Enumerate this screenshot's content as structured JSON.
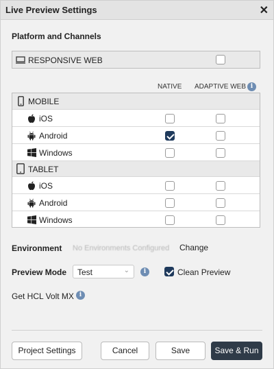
{
  "dialog": {
    "title": "Live Preview Settings",
    "close_glyph": "✕"
  },
  "platform_section": {
    "title": "Platform and Channels"
  },
  "responsive": {
    "label": "RESPONSIVE WEB",
    "checked": false
  },
  "columns": {
    "native": "NATIVE",
    "adaptive": "ADAPTIVE WEB",
    "info_glyph": "i"
  },
  "mobile": {
    "header": "MOBILE",
    "rows": [
      {
        "label": "iOS",
        "native": false,
        "adaptive": false
      },
      {
        "label": "Android",
        "native": true,
        "adaptive": false
      },
      {
        "label": "Windows",
        "native": false,
        "adaptive": false
      }
    ]
  },
  "tablet": {
    "header": "TABLET",
    "rows": [
      {
        "label": "iOS",
        "native": false,
        "adaptive": false
      },
      {
        "label": "Android",
        "native": false,
        "adaptive": false
      },
      {
        "label": "Windows",
        "native": false,
        "adaptive": false
      }
    ]
  },
  "environment": {
    "label": "Environment",
    "value": "No Environments Configured",
    "change": "Change"
  },
  "preview": {
    "label": "Preview Mode",
    "mode": "Test",
    "clean_label": "Clean Preview",
    "clean_checked": true
  },
  "get_volt": {
    "label": "Get HCL Volt MX"
  },
  "buttons": {
    "project_settings": "Project Settings",
    "cancel": "Cancel",
    "save": "Save",
    "save_run": "Save & Run"
  },
  "colors": {
    "accent": "#1f3a5c",
    "info": "#6e8db3",
    "primary_button": "#2f3b48"
  },
  "icons": {
    "responsive": "monitor-icon",
    "mobile": "phone-icon",
    "tablet": "tablet-icon",
    "ios": "apple-icon",
    "android": "android-icon",
    "windows": "windows-icon"
  }
}
